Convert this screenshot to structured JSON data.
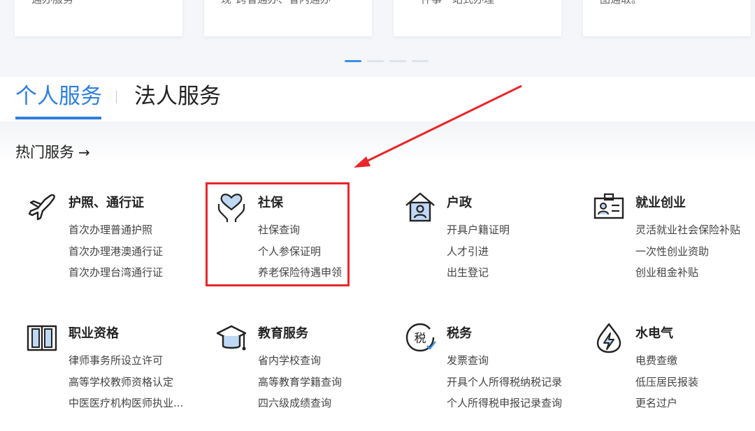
{
  "carousel": {
    "cards": [
      {
        "text": "通办服务"
      },
      {
        "text": "现\"跨省通办、省内通办\""
      },
      {
        "text": "一件事一站式办理"
      },
      {
        "text": "图通取。"
      }
    ],
    "active_index": 0,
    "count": 4
  },
  "tabs": {
    "personal": "个人服务",
    "legal": "法人服务",
    "active": "personal"
  },
  "hot": {
    "title": "热门服务",
    "arrow": "→"
  },
  "services": [
    {
      "title": "护照、通行证",
      "icon": "airplane-icon",
      "items": [
        "首次办理普通护照",
        "首次办理港澳通行证",
        "首次办理台湾通行证"
      ]
    },
    {
      "title": "社保",
      "icon": "heart-hands-icon",
      "items": [
        "社保查询",
        "个人参保证明",
        "养老保险待遇申领"
      ]
    },
    {
      "title": "户政",
      "icon": "house-person-icon",
      "items": [
        "开具户籍证明",
        "人才引进",
        "出生登记"
      ]
    },
    {
      "title": "就业创业",
      "icon": "id-card-icon",
      "items": [
        "灵活就业社会保险补贴",
        "一次性创业资助",
        "创业租金补贴"
      ]
    },
    {
      "title": "职业资格",
      "icon": "book-icon",
      "items": [
        "律师事务所设立许可",
        "高等学校教师资格认定",
        "中医医疗机构医师执业..."
      ]
    },
    {
      "title": "教育服务",
      "icon": "graduation-cap-icon",
      "items": [
        "省内学校查询",
        "高等教育学籍查询",
        "四六级成绩查询"
      ]
    },
    {
      "title": "税务",
      "icon": "tax-icon",
      "items": [
        "发票查询",
        "开具个人所得税纳税记录",
        "个人所得税申报记录查询"
      ]
    },
    {
      "title": "水电气",
      "icon": "water-drop-bolt-icon",
      "items": [
        "电费查缴",
        "低压居民报装",
        "更名过户"
      ]
    }
  ],
  "colors": {
    "accent": "#2f7fdc",
    "annotation": "#e8262b"
  }
}
